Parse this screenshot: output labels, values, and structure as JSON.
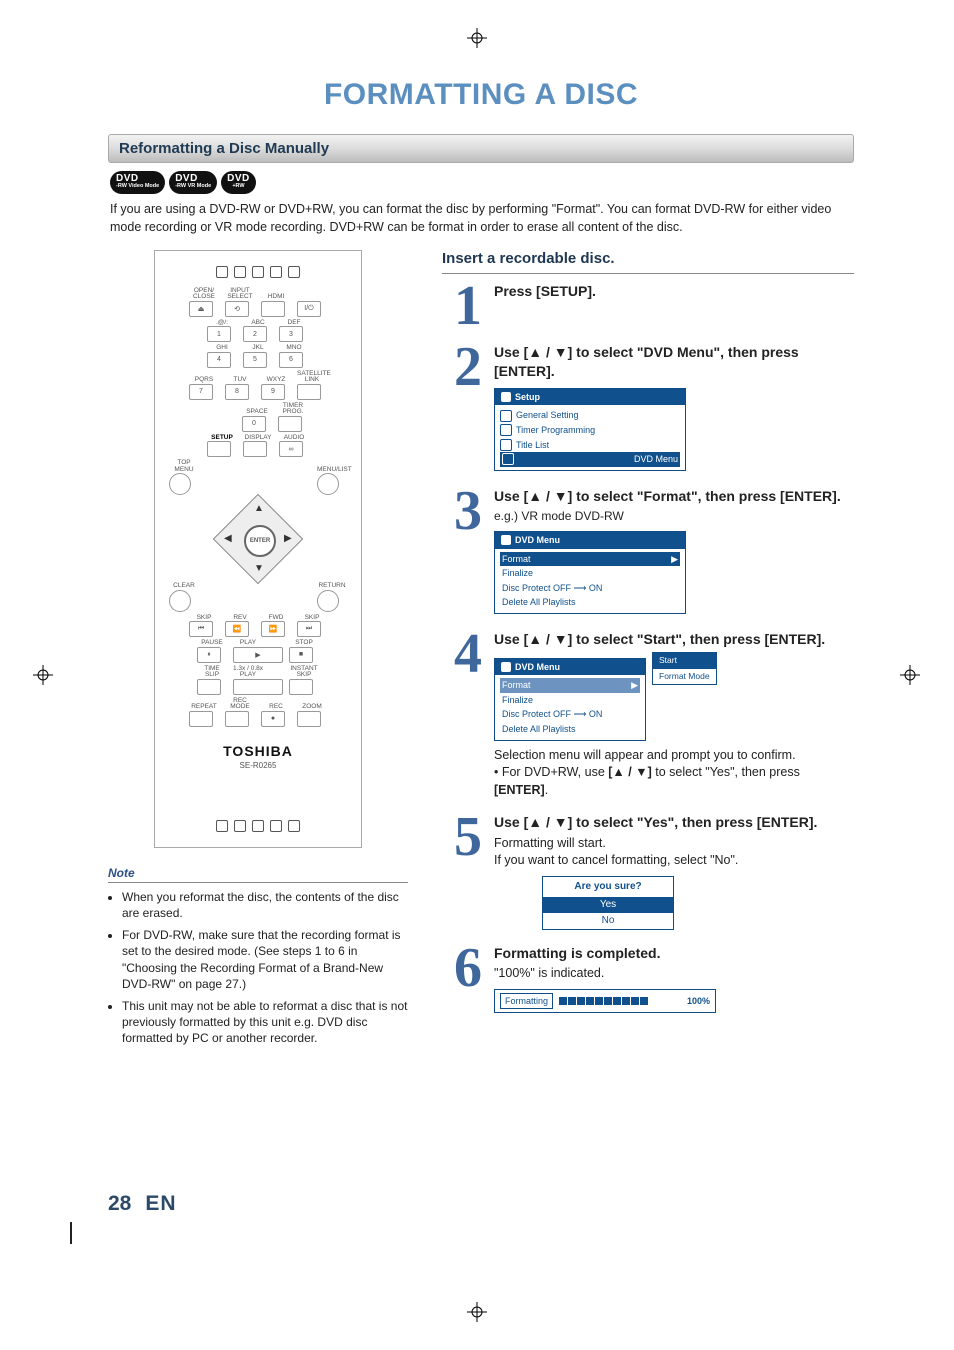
{
  "page_title": "FORMATTING A DISC",
  "section_bar": "Reformatting a Disc Manually",
  "dvd_badges": [
    {
      "top": "DVD",
      "sub": "-RW Video Mode"
    },
    {
      "top": "DVD",
      "sub": "-RW VR Mode"
    },
    {
      "top": "DVD",
      "sub": "+RW"
    }
  ],
  "intro": "If you are using a DVD-RW or DVD+RW, you can format the disc by performing \"Format\". You can format DVD-RW for either video mode recording or VR mode recording. DVD+RW can be format in order to erase all content of the disc.",
  "remote": {
    "top_labels": [
      "OPEN/\nCLOSE",
      "INPUT\nSELECT",
      "HDMI",
      ""
    ],
    "row2_labels": [
      ".@/:",
      "ABC",
      "DEF"
    ],
    "row2_nums": [
      "1",
      "2",
      "3"
    ],
    "row3_labels": [
      "GHI",
      "JKL",
      "MNO"
    ],
    "row3_nums": [
      "4",
      "5",
      "6"
    ],
    "row4_labels": [
      "PQRS",
      "TUV",
      "WXYZ"
    ],
    "row4_nums": [
      "7",
      "8",
      "9"
    ],
    "satellite": "SATELLITE\nLINK",
    "space_label": "SPACE",
    "space_num": "0",
    "timer": "TIMER\nPROG.",
    "row_setup": [
      "SETUP",
      "DISPLAY",
      "AUDIO"
    ],
    "top_menu": "TOP MENU",
    "menu_list": "MENU/LIST",
    "enter": "ENTER",
    "clear": "CLEAR",
    "return": "RETURN",
    "trans_row1_lbl": [
      "SKIP",
      "REV",
      "FWD",
      "SKIP"
    ],
    "trans_row2_lbl": [
      "PAUSE",
      "PLAY",
      "STOP"
    ],
    "trans_row3_lbl": [
      "TIME SLIP",
      "1.3x / 0.8x PLAY",
      "INSTANT SKIP"
    ],
    "trans_row4_lbl": [
      "REPEAT",
      "REC MODE",
      "REC",
      "ZOOM"
    ],
    "brand": "TOSHIBA",
    "model": "SE-R0265"
  },
  "instr_heading": "Insert a recordable disc.",
  "steps": [
    {
      "n": "1",
      "title": "Press [SETUP]."
    },
    {
      "n": "2",
      "title_pre": "Use [",
      "title_mid": " / ",
      "title_post": "] to select \"DVD Menu\", then press [ENTER].",
      "osd": {
        "title": "Setup",
        "items": [
          {
            "label": "General Setting",
            "hl": false
          },
          {
            "label": "Timer Programming",
            "hl": false
          },
          {
            "label": "Title List",
            "hl": false
          },
          {
            "label": "DVD Menu",
            "hl": true
          }
        ]
      }
    },
    {
      "n": "3",
      "title_pre": "Use [",
      "title_mid": " / ",
      "title_post": "] to select \"Format\", then press [ENTER].",
      "eg": "e.g.) VR mode DVD-RW",
      "osd": {
        "title": "DVD Menu",
        "items": [
          {
            "label": "Format",
            "hl": true,
            "arrow": true
          },
          {
            "label": "Finalize",
            "hl": false
          },
          {
            "label": "Disc Protect OFF ⟶ ON",
            "hl": false
          },
          {
            "label": "Delete All Playlists",
            "hl": false
          }
        ]
      }
    },
    {
      "n": "4",
      "title_pre": "Use [",
      "title_mid": " / ",
      "title_post": "] to select \"Start\", then press [ENTER].",
      "osd": {
        "title": "DVD Menu",
        "items": [
          {
            "label": "Format",
            "hl": true,
            "arrow": true
          },
          {
            "label": "Finalize",
            "hl": false
          },
          {
            "label": "Disc Protect OFF ⟶ ON",
            "hl": false
          },
          {
            "label": "Delete All Playlists",
            "hl": false
          }
        ],
        "popup": [
          {
            "label": "Start",
            "hl": true
          },
          {
            "label": "Format Mode",
            "hl": false
          }
        ]
      },
      "after1": "Selection menu will appear and prompt you to confirm.",
      "after2_pre": "• For DVD+RW, use ",
      "after2_mid": " to select \"Yes\", then press ",
      "after2_enter": "[ENTER]",
      "after2_post": "."
    },
    {
      "n": "5",
      "title_pre": "Use [",
      "title_mid": " / ",
      "title_post": "] to select \"Yes\", then press [ENTER].",
      "line1": "Formatting will start.",
      "line2": "If you want to cancel formatting, select \"No\".",
      "confirm": {
        "head": "Are you sure?",
        "yes": "Yes",
        "no": "No"
      }
    },
    {
      "n": "6",
      "title": "Formatting is completed.",
      "line1": "\"100%\" is indicated.",
      "progress": {
        "label": "Formatting",
        "pct": "100%"
      }
    }
  ],
  "note": {
    "title": "Note",
    "items": [
      "When you reformat the disc, the contents of the disc are erased.",
      "For DVD-RW, make sure that the recording format is set to the desired mode. (See steps 1 to 6 in \"Choosing the Recording Format of a Brand-New DVD-RW\" on page 27.)",
      "This unit may not be able to reformat a disc that is not previously formatted by this unit e.g. DVD disc formatted by PC or another recorder."
    ]
  },
  "footer": {
    "page": "28",
    "lang": "EN"
  }
}
